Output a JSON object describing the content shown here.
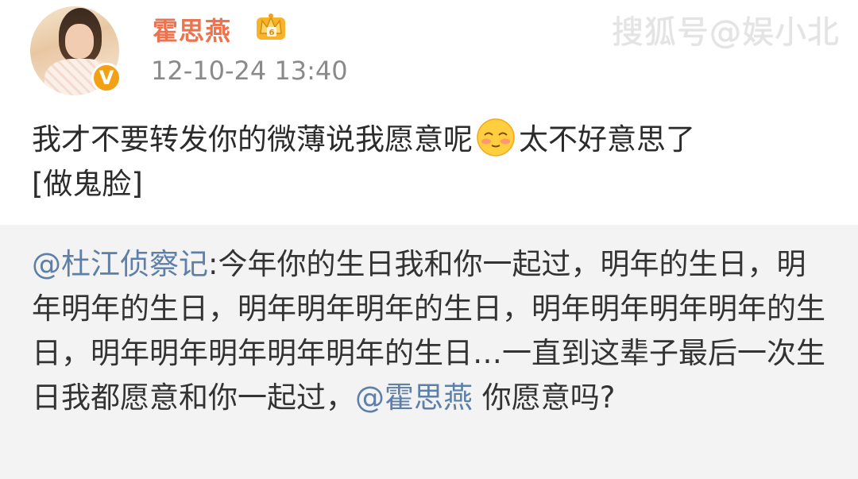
{
  "watermark": "搜狐号@娱小北",
  "user": {
    "name": "霍思燕",
    "verified_badge": "V",
    "timestamp": "12-10-24 13:40"
  },
  "post": {
    "text_before_emoji": "我才不要转发你的微薄说我愿意呢",
    "emoji": "shy-blush-emoji",
    "text_after_emoji": "太不好意思了",
    "emoticon_tag": "[做鬼脸]"
  },
  "repost": {
    "author_mention": "@杜江侦察记",
    "body": ":今年你的生日我和你一起过，明年的生日，明年明年的生日，明年明年明年的生日，明年明年明年明年的生日，明年明年明年明年明年的生日…一直到这辈子最后一次生日我都愿意和你一起过，",
    "tagged_mention": "@霍思燕",
    "ending": " 你愿意吗?"
  },
  "colors": {
    "username": "#eb7350",
    "mention": "#5d7fa8",
    "repost_bg": "#f3f3f3",
    "badge": "#f3a114"
  }
}
